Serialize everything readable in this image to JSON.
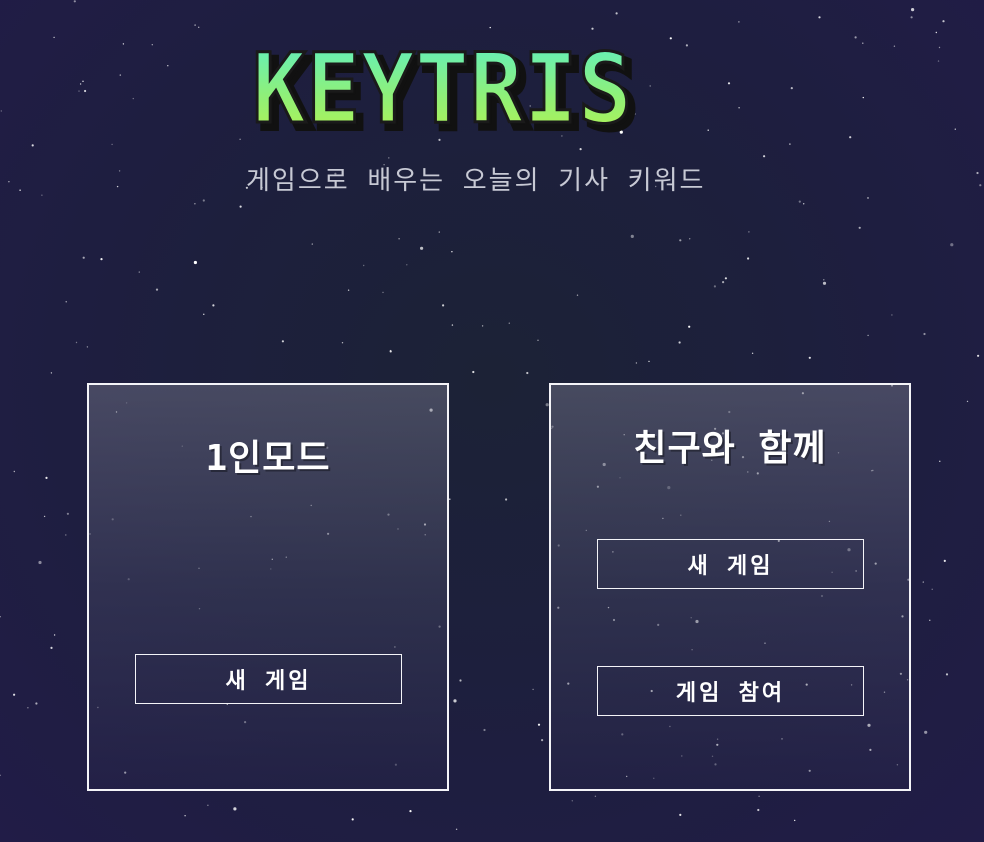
{
  "header": {
    "logo_text": "KEYTRIS",
    "subtitle": "게임으로 배우는 오늘의 기사 키워드"
  },
  "single_mode": {
    "title": "1인모드",
    "new_game_label": "새 게임"
  },
  "multi_mode": {
    "title": "친구와 함께",
    "new_game_label": "새 게임",
    "join_game_label": "게임 참여"
  },
  "colors": {
    "background": "#1d1f3d",
    "logo_fill_top": "#5af0c8",
    "logo_fill_bottom": "#b8f24a",
    "logo_shadow": "#111111",
    "panel_border": "#f4f4f8",
    "subtitle": "#c7c9d4"
  }
}
